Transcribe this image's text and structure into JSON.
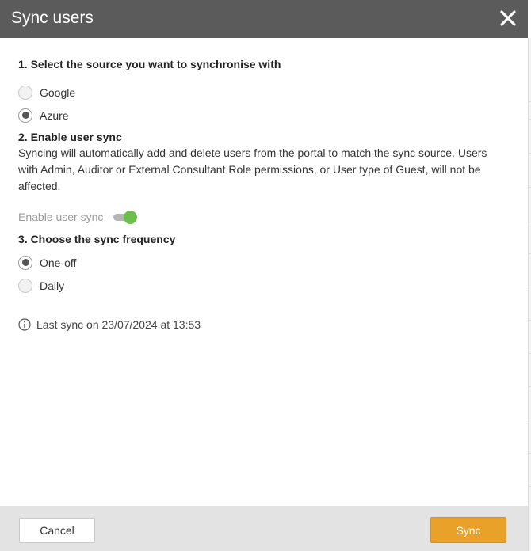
{
  "dialog": {
    "title": "Sync users",
    "close_icon": "close-icon"
  },
  "source": {
    "heading": "1. Select the source you want to synchronise with",
    "options": [
      {
        "label": "Google",
        "checked": false
      },
      {
        "label": "Azure",
        "checked": true
      }
    ]
  },
  "user_sync": {
    "heading": "2. Enable user sync",
    "description": "Syncing will automatically add and delete users from the portal to match the sync source. Users with Admin, Auditor or External Consultant Role permissions, or User type of Guest, will not be affected.",
    "toggle_label": "Enable user sync",
    "enabled": true
  },
  "frequency": {
    "heading": "3. Choose the sync frequency",
    "options": [
      {
        "label": "One-off",
        "checked": true
      },
      {
        "label": "Daily",
        "checked": false
      }
    ]
  },
  "last_sync": {
    "icon": "info-icon",
    "text": "Last sync on 23/07/2024 at 13:53"
  },
  "footer": {
    "cancel_label": "Cancel",
    "sync_label": "Sync"
  },
  "colors": {
    "header_bg": "#5b5b5b",
    "toggle_on": "#6cc04a",
    "primary_button": "#e9a12a",
    "footer_bg": "#e3e3e3"
  }
}
